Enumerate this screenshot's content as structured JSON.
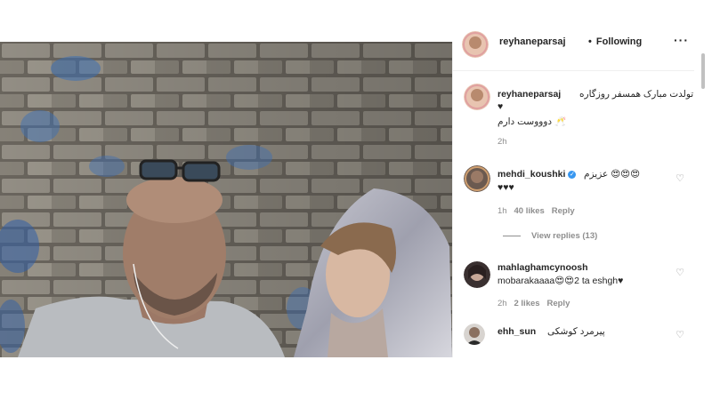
{
  "post": {
    "author": "reyhaneparsaj",
    "follow_status": "Following",
    "separator": "•",
    "more": "···"
  },
  "caption": {
    "user": "reyhaneparsaj",
    "line1": "تولدت مبارک همسفر روزگاره",
    "line2": "♥",
    "line3": "دوووست دارم 🥂",
    "time": "2h"
  },
  "comments": [
    {
      "user": "mehdi_koushki",
      "verified": true,
      "text1": "عزیزم 😍😍😍",
      "text2": "♥♥♥",
      "time": "1h",
      "likes": "40 likes",
      "reply": "Reply",
      "view_replies": "View replies (13)"
    },
    {
      "user": "mahlaghamcynoosh",
      "text1": "mobarakaaaa😍😍2 ta eshgh♥",
      "time": "2h",
      "likes": "2 likes",
      "reply": "Reply"
    },
    {
      "user": "ehh_sun",
      "text1": "پیرمرد کوشکی"
    }
  ],
  "icons": {
    "like": "heart-outline-icon",
    "more": "ellipsis-icon"
  }
}
